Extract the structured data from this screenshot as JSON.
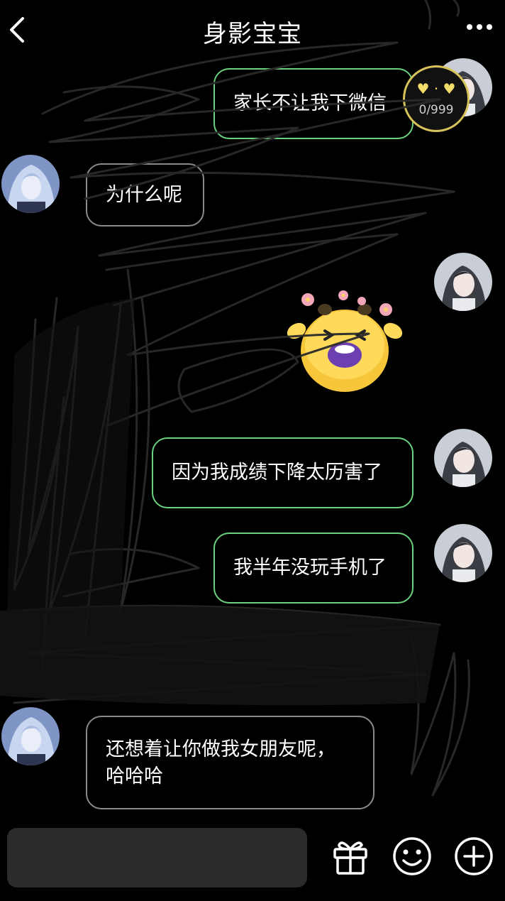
{
  "header": {
    "title": "身影宝宝"
  },
  "score_badge": {
    "count": "0/999"
  },
  "messages": [
    {
      "sender": "me",
      "text": "家长不让我下微信"
    },
    {
      "sender": "them",
      "text": "为什么呢"
    },
    {
      "sender": "me",
      "type": "sticker",
      "sticker_name": "happy-flower-emoji"
    },
    {
      "sender": "me",
      "text": "因为我成绩下降太历害了"
    },
    {
      "sender": "me",
      "text": "我半年没玩手机了"
    },
    {
      "sender": "them",
      "text": "还想着让你做我女朋友呢，哈哈哈"
    }
  ],
  "message_lines": {
    "last_line1": "还想着让你做我女朋友呢，",
    "last_line2": "哈哈哈"
  },
  "colors": {
    "background": "#000000",
    "my_bubble_border": "#6ad27e",
    "their_bubble_border": "#8a8a8a",
    "input_bg": "#2b2b2b",
    "badge_border": "#d8c35a"
  },
  "toolbar": {
    "icons": [
      "gift-icon",
      "emoji-icon",
      "plus-icon"
    ]
  }
}
